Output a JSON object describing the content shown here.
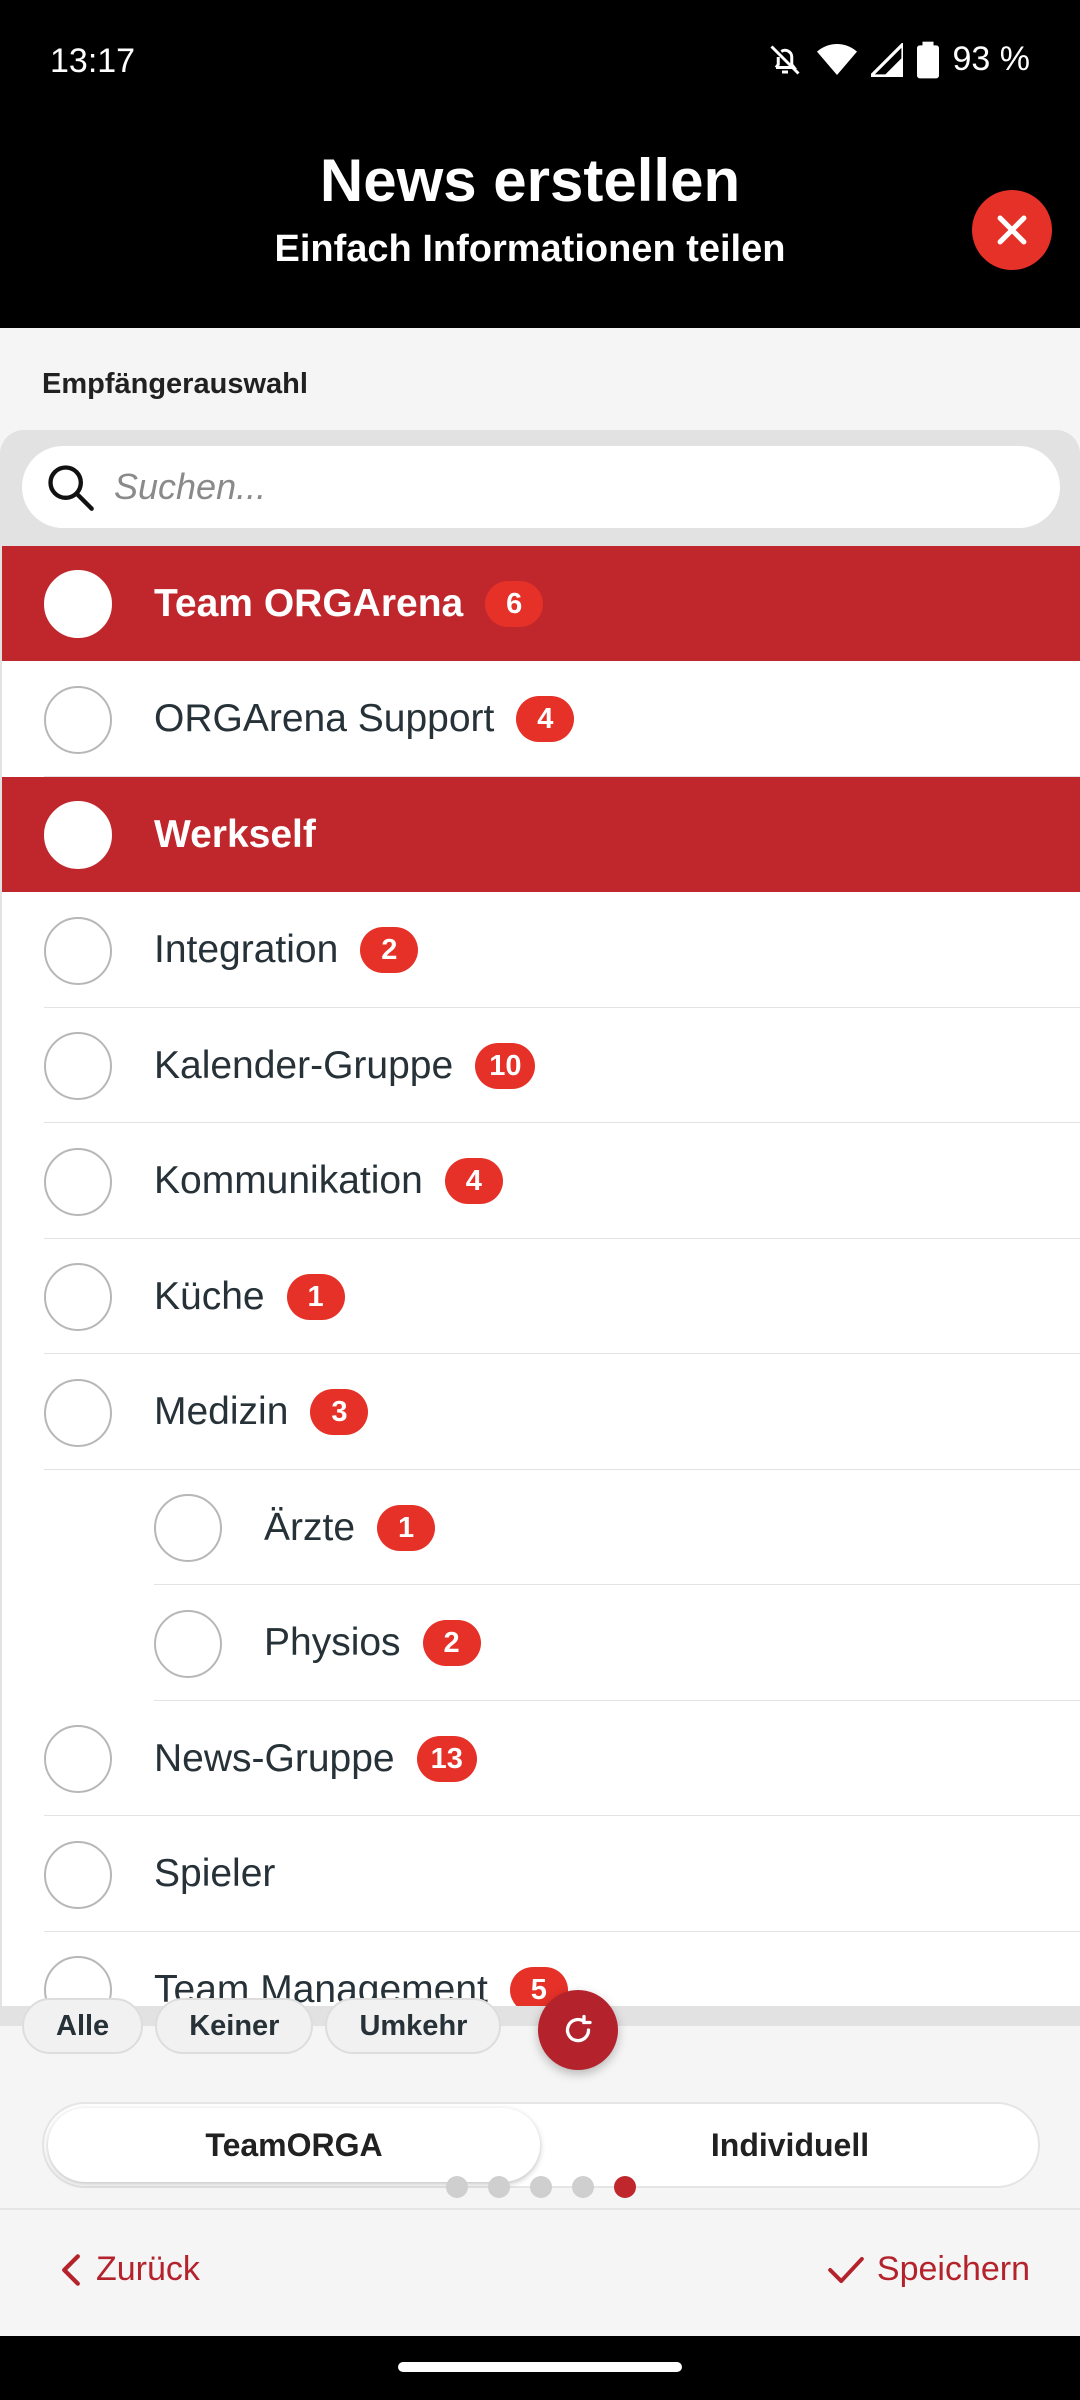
{
  "status": {
    "time": "13:17",
    "battery": "93 %"
  },
  "header": {
    "title": "News erstellen",
    "subtitle": "Einfach Informationen teilen"
  },
  "section_label": "Empfängerauswahl",
  "search": {
    "placeholder": "Suchen..."
  },
  "list": [
    {
      "label": "Team ORGArena",
      "count": "6",
      "selected": true,
      "indent": 0
    },
    {
      "label": "ORGArena Support",
      "count": "4",
      "selected": false,
      "indent": 0
    },
    {
      "label": "Werkself",
      "count": "",
      "selected": true,
      "indent": 0
    },
    {
      "label": "Integration",
      "count": "2",
      "selected": false,
      "indent": 0
    },
    {
      "label": "Kalender-Gruppe",
      "count": "10",
      "selected": false,
      "indent": 0
    },
    {
      "label": "Kommunikation",
      "count": "4",
      "selected": false,
      "indent": 0
    },
    {
      "label": "Küche",
      "count": "1",
      "selected": false,
      "indent": 0
    },
    {
      "label": "Medizin",
      "count": "3",
      "selected": false,
      "indent": 0
    },
    {
      "label": "Ärzte",
      "count": "1",
      "selected": false,
      "indent": 1
    },
    {
      "label": "Physios",
      "count": "2",
      "selected": false,
      "indent": 1
    },
    {
      "label": "News-Gruppe",
      "count": "13",
      "selected": false,
      "indent": 0
    },
    {
      "label": "Spieler",
      "count": "",
      "selected": false,
      "indent": 0
    },
    {
      "label": "Team Management",
      "count": "5",
      "selected": false,
      "indent": 0
    }
  ],
  "chips": {
    "all": "Alle",
    "none": "Keiner",
    "invert": "Umkehr"
  },
  "toggle": {
    "teamorga": "TeamORGA",
    "individual": "Individuell"
  },
  "pagination": {
    "active": 5,
    "total": 5
  },
  "footer": {
    "back": "Zurück",
    "save": "Speichern"
  },
  "colors": {
    "accent": "#c0272d",
    "badge": "#e53127",
    "header_bg": "#000000"
  },
  "icons": {
    "close": "close-icon",
    "search": "search-icon",
    "refresh": "refresh-icon",
    "back": "chevron-left-icon",
    "save": "check-icon"
  }
}
